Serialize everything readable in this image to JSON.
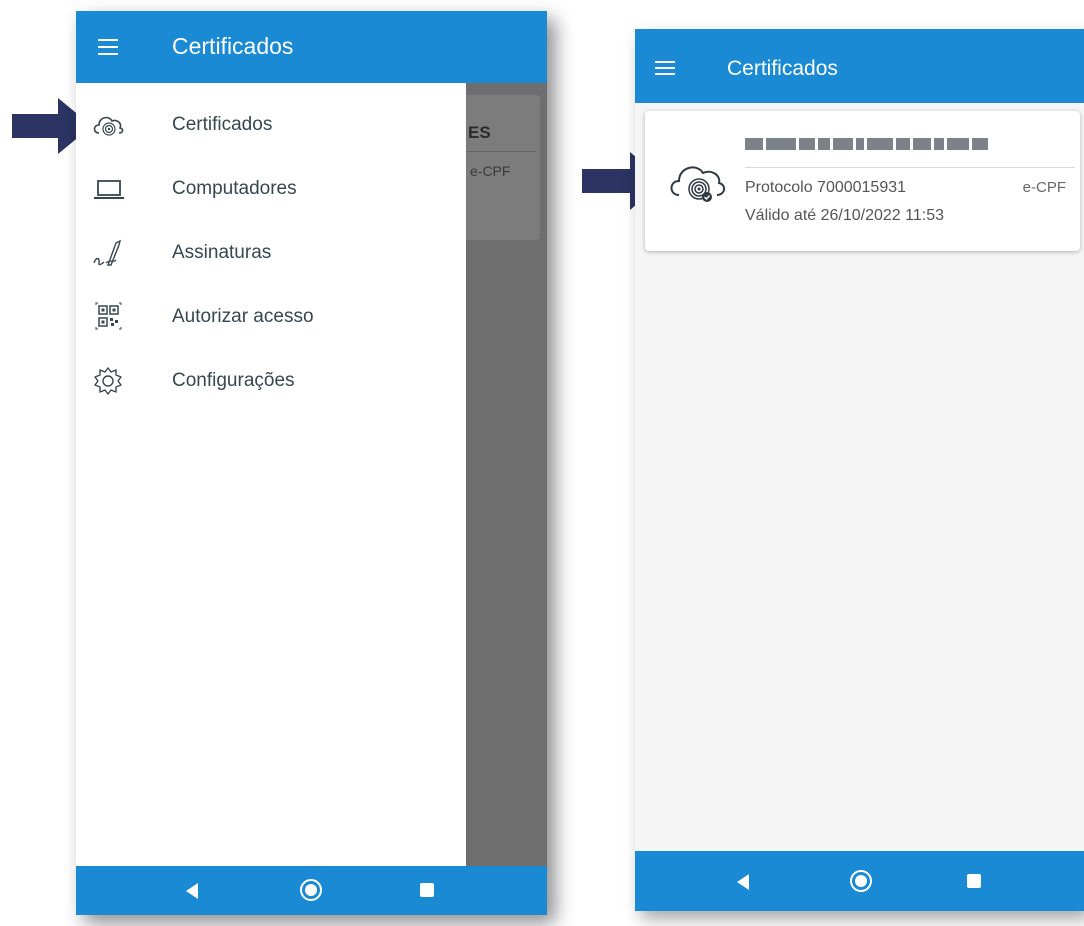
{
  "left_screen": {
    "app_bar": {
      "title": "Certificados",
      "menu_icon": "hamburger-menu-icon"
    },
    "background_fragment": {
      "title": "ES",
      "type": "e-CPF"
    },
    "drawer": {
      "items": [
        {
          "label": "Certificados",
          "icon": "cloud-fingerprint-icon"
        },
        {
          "label": "Computadores",
          "icon": "laptop-icon"
        },
        {
          "label": "Assinaturas",
          "icon": "signature-pen-icon"
        },
        {
          "label": "Autorizar acesso",
          "icon": "qr-code-icon"
        },
        {
          "label": "Configurações",
          "icon": "gear-icon"
        }
      ]
    },
    "nav_bar": {
      "back_icon": "back-triangle-icon",
      "home_icon": "home-circle-icon",
      "recent_icon": "recent-square-icon"
    }
  },
  "right_screen": {
    "app_bar": {
      "title": "Certificados",
      "menu_icon": "hamburger-menu-icon"
    },
    "certificate": {
      "name_redacted": true,
      "protocol": "Protocolo 7000015931",
      "type": "e-CPF",
      "validity": "Válido até 26/10/2022 11:53",
      "icon": "cloud-fingerprint-check-icon"
    },
    "nav_bar": {
      "back_icon": "back-triangle-icon",
      "home_icon": "home-circle-icon",
      "recent_icon": "recent-square-icon"
    }
  },
  "colors": {
    "primary": "#1a8ad4",
    "arrow": "#2b3462",
    "drawer_text": "#37474f",
    "scrim": "#6e6e6e"
  }
}
